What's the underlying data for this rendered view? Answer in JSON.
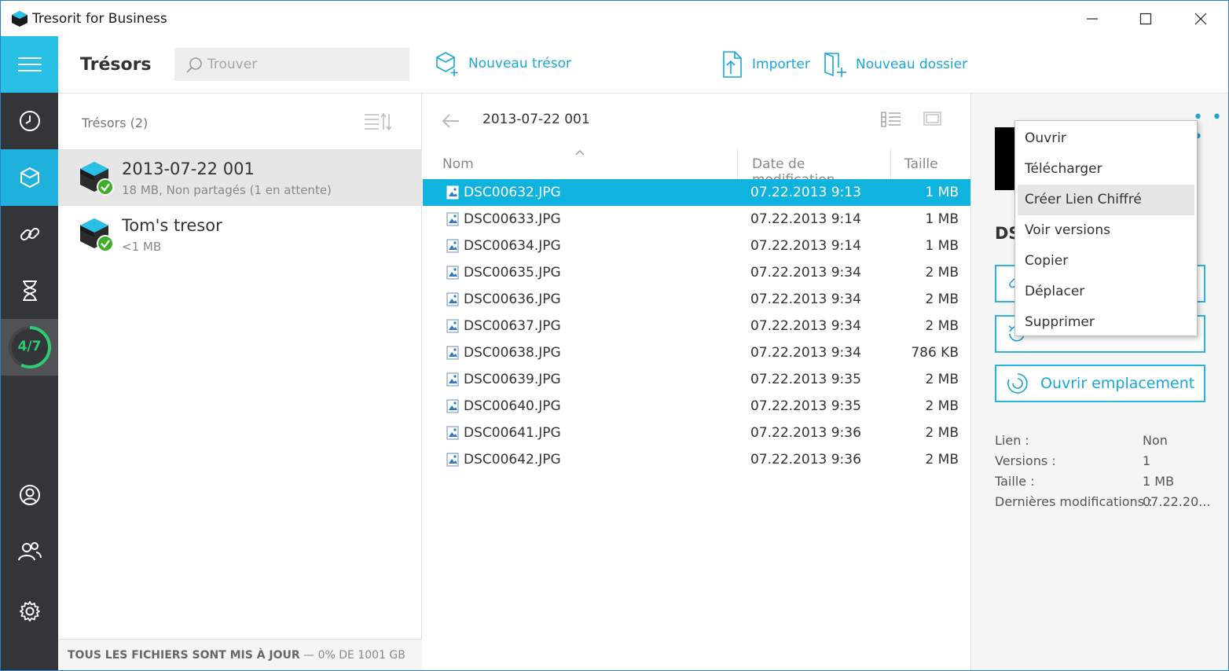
{
  "window": {
    "title": "Tresorit for Business"
  },
  "toolbar": {
    "page_title": "Trésors",
    "search_placeholder": "Trouver",
    "new_vault": "Nouveau trésor",
    "import": "Importer",
    "new_folder": "Nouveau dossier"
  },
  "sidebar": {
    "progress_label": "4/7",
    "progress_fraction": 0.571
  },
  "vaults": {
    "header": "Trésors (2)",
    "items": [
      {
        "name": "2013-07-22 001",
        "subtitle": "18 MB, Non partagés (1 en attente)"
      },
      {
        "name": "Tom's tresor",
        "subtitle": "<1 MB"
      }
    ],
    "footer_status": "TOUS LES FICHIERS SONT MIS À JOUR",
    "footer_usage": "— 0% DE 1001 GB"
  },
  "files": {
    "path": "2013-07-22 001",
    "columns": {
      "name": "Nom",
      "date": "Date de modification",
      "size": "Taille"
    },
    "rows": [
      {
        "name": "DSC00632.JPG",
        "date": "07.22.2013 9:13",
        "size": "1 MB"
      },
      {
        "name": "DSC00633.JPG",
        "date": "07.22.2013 9:14",
        "size": "1 MB"
      },
      {
        "name": "DSC00634.JPG",
        "date": "07.22.2013 9:14",
        "size": "1 MB"
      },
      {
        "name": "DSC00635.JPG",
        "date": "07.22.2013 9:34",
        "size": "2 MB"
      },
      {
        "name": "DSC00636.JPG",
        "date": "07.22.2013 9:34",
        "size": "2 MB"
      },
      {
        "name": "DSC00637.JPG",
        "date": "07.22.2013 9:34",
        "size": "2 MB"
      },
      {
        "name": "DSC00638.JPG",
        "date": "07.22.2013 9:34",
        "size": "786 KB"
      },
      {
        "name": "DSC00639.JPG",
        "date": "07.22.2013 9:35",
        "size": "2 MB"
      },
      {
        "name": "DSC00640.JPG",
        "date": "07.22.2013 9:35",
        "size": "2 MB"
      },
      {
        "name": "DSC00641.JPG",
        "date": "07.22.2013 9:36",
        "size": "2 MB"
      },
      {
        "name": "DSC00642.JPG",
        "date": "07.22.2013 9:36",
        "size": "2 MB"
      }
    ]
  },
  "details": {
    "more": "• • •",
    "filename_partial": "DS",
    "button_open_location": "Ouvrir emplacement",
    "meta": [
      {
        "key": "Lien :",
        "value": "Non"
      },
      {
        "key": "Versions :",
        "value": "1"
      },
      {
        "key": "Taille :",
        "value": "1 MB"
      },
      {
        "key": "Dernières modifications :",
        "value": "07.22.20..."
      }
    ]
  },
  "context_menu": {
    "items": [
      "Ouvrir",
      "Télécharger",
      "Créer Lien Chiffré",
      "Voir versions",
      "Copier",
      "Déplacer",
      "Supprimer"
    ]
  },
  "colors": {
    "accent": "#17a6d8",
    "selection": "#10b2de",
    "sidebar": "#333538",
    "progress": "#2ecc71",
    "check": "#3fae29"
  }
}
